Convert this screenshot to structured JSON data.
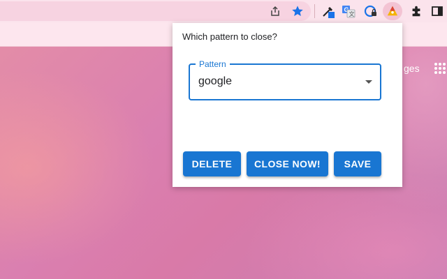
{
  "toolbar": {
    "icons": [
      "share-icon",
      "bookmark-star-icon",
      "color-picker-extension-icon",
      "translate-extension-icon",
      "password-extension-icon",
      "tab-closer-extension-icon",
      "extensions-puzzle-icon",
      "side-panel-icon"
    ]
  },
  "page": {
    "partial_link": "ges"
  },
  "popup": {
    "title": "Which pattern to close?",
    "pattern_label": "Pattern",
    "pattern_value": "google",
    "buttons": {
      "delete": "DELETE",
      "close_now": "CLOSE NOW!",
      "save": "SAVE"
    }
  },
  "colors": {
    "accent": "#1976d2",
    "star": "#1a73e8"
  }
}
